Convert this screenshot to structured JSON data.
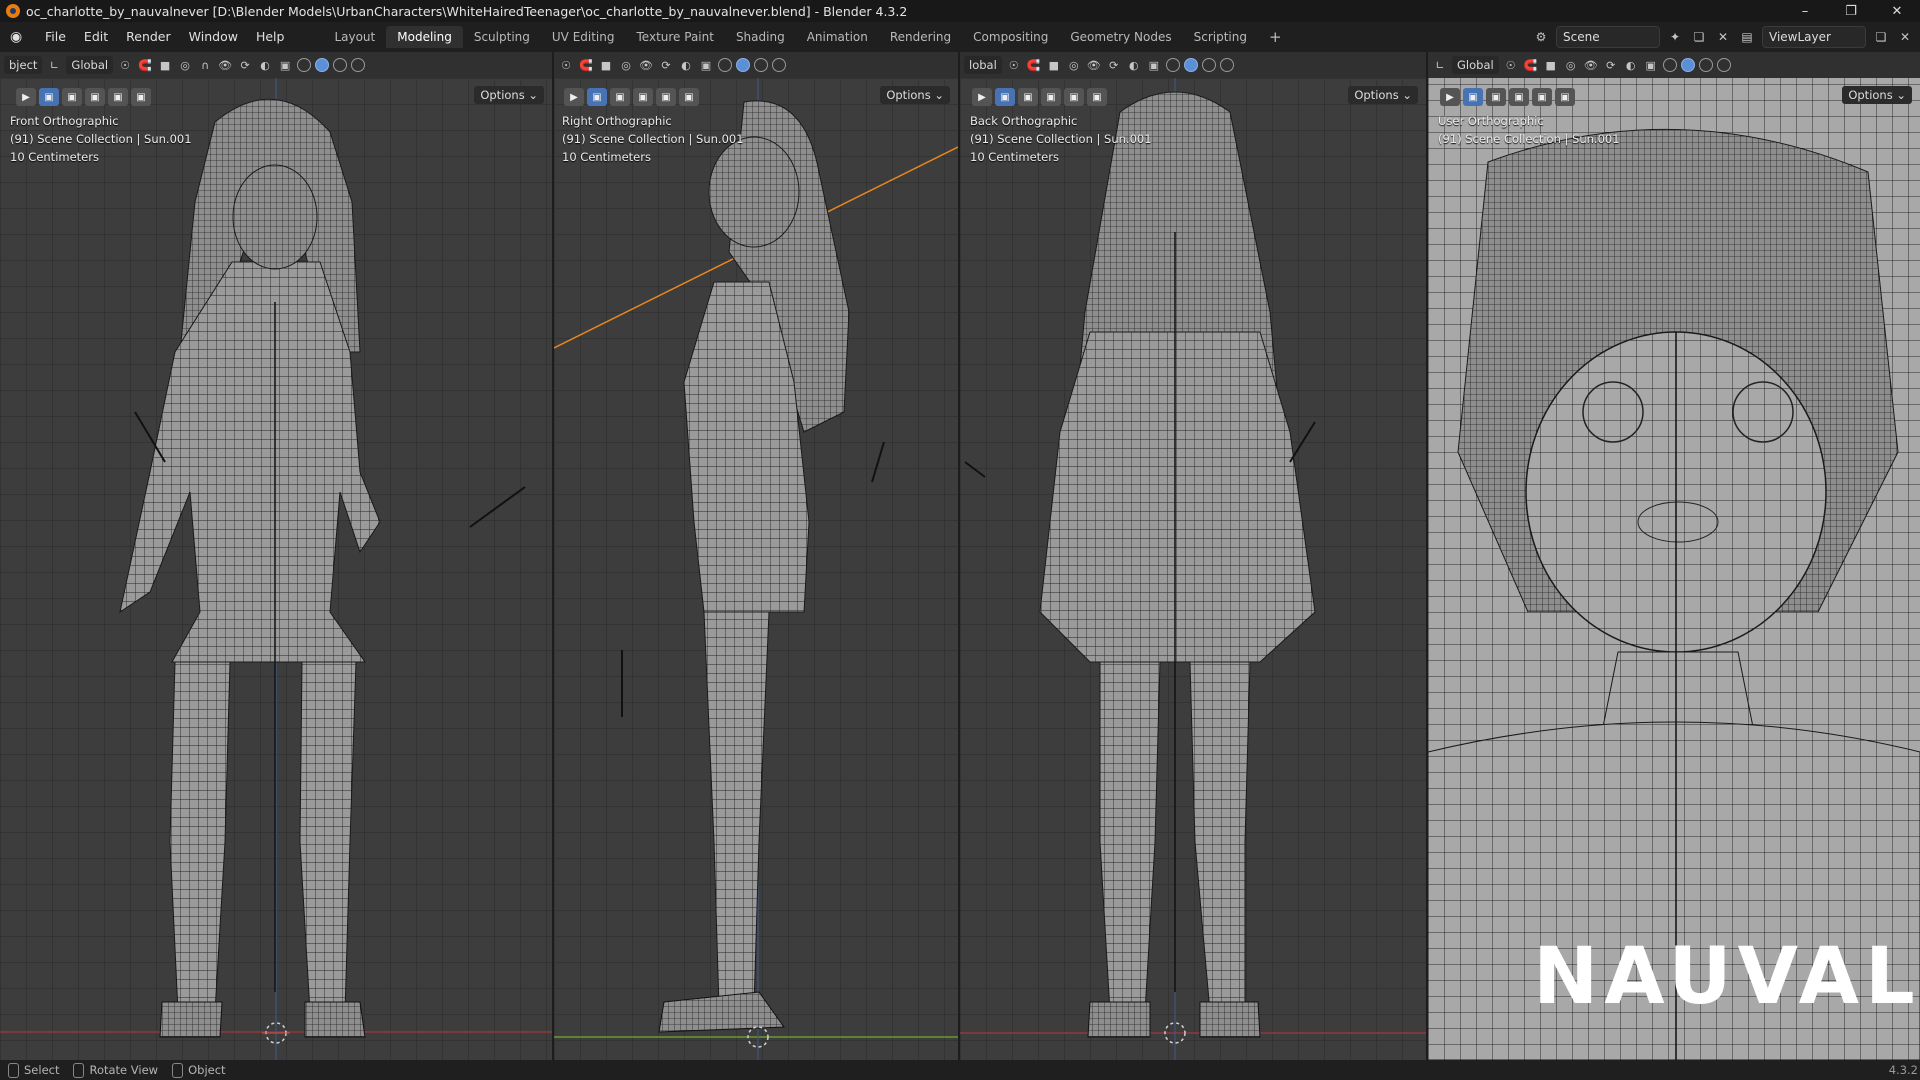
{
  "window": {
    "title": "oc_charlotte_by_nauvalnever [D:\\Blender Models\\UrbanCharacters\\WhiteHairedTeenager\\oc_charlotte_by_nauvalnever.blend] - Blender 4.3.2",
    "controls": [
      "–",
      "❐",
      "✕"
    ]
  },
  "menu": {
    "items": [
      "File",
      "Edit",
      "Render",
      "Window",
      "Help"
    ]
  },
  "workspaces": {
    "tabs": [
      "Layout",
      "Modeling",
      "Sculpting",
      "UV Editing",
      "Texture Paint",
      "Shading",
      "Animation",
      "Rendering",
      "Compositing",
      "Geometry Nodes",
      "Scripting"
    ],
    "active": "Modeling",
    "add": "+"
  },
  "scene": {
    "name": "Scene",
    "view_layer": "ViewLayer"
  },
  "viewports": [
    {
      "mode": "bject",
      "orientation": "Global",
      "view": "Front Orthographic",
      "collection": "(91) Scene Collection | Sun.001",
      "scale": "10 Centimeters",
      "options": "Options"
    },
    {
      "mode": "",
      "orientation": "",
      "view": "Right Orthographic",
      "collection": "(91) Scene Collection | Sun.001",
      "scale": "10 Centimeters",
      "options": "Options"
    },
    {
      "mode": "lobal",
      "orientation": "",
      "view": "Back Orthographic",
      "collection": "(91) Scene Collection | Sun.001",
      "scale": "10 Centimeters",
      "options": "Options"
    },
    {
      "mode": "",
      "orientation": "Global",
      "view": "User Orthographic",
      "collection": "(91) Scene Collection | Sun.001",
      "scale": "",
      "options": "Options"
    }
  ],
  "watermark": "NAUVAL",
  "status": {
    "select": "Select",
    "rotate": "Rotate View",
    "object": "Object",
    "version": "4.3.2"
  },
  "colors": {
    "accent": "#4772b3",
    "sun_line": "#e8891c",
    "x_axis": "#b53737",
    "y_axis": "#6a9a2e"
  }
}
